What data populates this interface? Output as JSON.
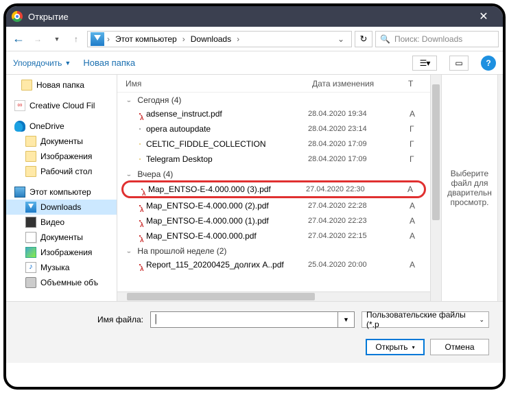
{
  "window": {
    "title": "Открытие"
  },
  "nav": {
    "crumb1": "Этот компьютер",
    "crumb2": "Downloads",
    "search_placeholder": "Поиск: Downloads"
  },
  "toolbar": {
    "organize": "Упорядочить",
    "newfolder": "Новая папка"
  },
  "sidebar": {
    "items": [
      {
        "label": "Новая папка",
        "icon": "folder",
        "indent": 22
      },
      {
        "label": "Creative Cloud Fil",
        "icon": "cc",
        "indent": 12,
        "gap": true
      },
      {
        "label": "OneDrive",
        "icon": "onedrive",
        "indent": 12,
        "gap": true
      },
      {
        "label": "Документы",
        "icon": "folder",
        "indent": 28
      },
      {
        "label": "Изображения",
        "icon": "folder",
        "indent": 28
      },
      {
        "label": "Рабочий стол",
        "icon": "folder",
        "indent": 28
      },
      {
        "label": "Этот компьютер",
        "icon": "pc",
        "indent": 12,
        "gap": true
      },
      {
        "label": "Downloads",
        "icon": "down",
        "indent": 28,
        "selected": true
      },
      {
        "label": "Видео",
        "icon": "video",
        "indent": 28
      },
      {
        "label": "Документы",
        "icon": "docs",
        "indent": 28
      },
      {
        "label": "Изображения",
        "icon": "pics",
        "indent": 28
      },
      {
        "label": "Музыка",
        "icon": "music",
        "indent": 28
      },
      {
        "label": "Объемные объ",
        "icon": "disk",
        "indent": 28
      }
    ]
  },
  "columns": {
    "name": "Имя",
    "date": "Дата изменения",
    "type": "Т"
  },
  "groups": [
    {
      "title": "Сегодня (4)",
      "rows": [
        {
          "icon": "pdf",
          "name": "adsense_instruct.pdf",
          "date": "28.04.2020 19:34",
          "t": "A"
        },
        {
          "icon": "file",
          "name": "opera autoupdate",
          "date": "28.04.2020 23:14",
          "t": "Г"
        },
        {
          "icon": "folder",
          "name": "CELTIC_FIDDLE_COLLECTION",
          "date": "28.04.2020 17:09",
          "t": "Г"
        },
        {
          "icon": "folder",
          "name": "Telegram Desktop",
          "date": "28.04.2020 17:09",
          "t": "Г"
        }
      ]
    },
    {
      "title": "Вчера (4)",
      "rows": [
        {
          "icon": "pdf",
          "name": "Map_ENTSO-E-4.000.000 (3).pdf",
          "date": "27.04.2020 22:30",
          "t": "A",
          "highlight": true
        },
        {
          "icon": "pdf",
          "name": "Map_ENTSO-E-4.000.000 (2).pdf",
          "date": "27.04.2020 22:28",
          "t": "A"
        },
        {
          "icon": "pdf",
          "name": "Map_ENTSO-E-4.000.000 (1).pdf",
          "date": "27.04.2020 22:23",
          "t": "A"
        },
        {
          "icon": "pdf",
          "name": "Map_ENTSO-E-4.000.000.pdf",
          "date": "27.04.2020 22:15",
          "t": "A"
        }
      ]
    },
    {
      "title": "На прошлой неделе (2)",
      "rows": [
        {
          "icon": "pdf",
          "name": "Report_115_20200425_долгих А..pdf",
          "date": "25.04.2020 20:00",
          "t": "A"
        }
      ]
    }
  ],
  "preview": {
    "text": "Выберите файл для дварительн просмотр."
  },
  "footer": {
    "filename_label": "Имя файла:",
    "filter": "Пользовательские файлы (*.p",
    "open": "Открыть",
    "cancel": "Отмена"
  }
}
